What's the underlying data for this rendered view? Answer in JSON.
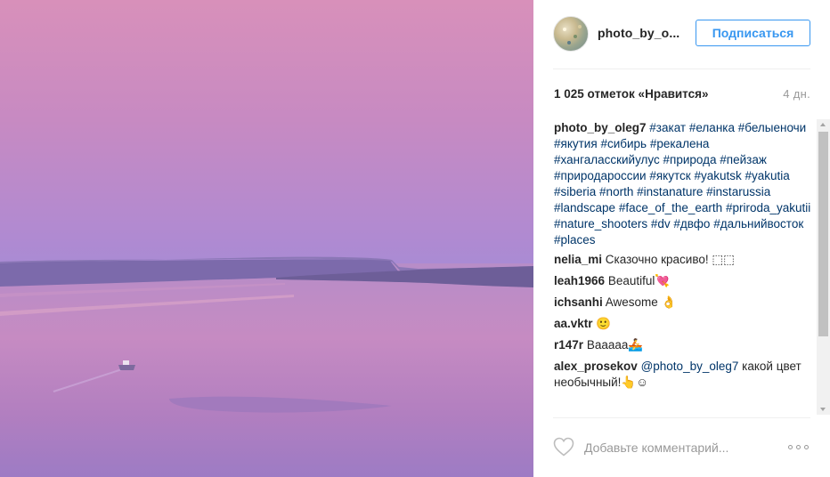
{
  "post": {
    "username": "photo_by_o...",
    "follow_label": "Подписаться",
    "likes": "1 025 отметок «Нравится»",
    "time": "4 дн.",
    "caption": {
      "user": "photo_by_oleg7",
      "tags": [
        "#закат",
        "#еланка",
        "#белыеночи",
        "#якутия",
        "#сибирь",
        "#рекалена",
        "#хангаласскийулус",
        "#природа",
        "#пейзаж",
        "#природароссии",
        "#якутск",
        "#yakutsk",
        "#yakutia",
        "#siberia",
        "#north",
        "#instanature",
        "#instarussia",
        "#landscape",
        "#face_of_the_earth",
        "#priroda_yakutii",
        "#nature_shooters",
        "#dv",
        "#двфо",
        "#дальнийвосток",
        "#places"
      ]
    },
    "comments": [
      {
        "user": "nelia_mi",
        "text": "Сказочно красиво! ⬚⬚"
      },
      {
        "user": "leah1966",
        "text": "Beautiful💘"
      },
      {
        "user": "ichsanhi",
        "text": "Awesome 👌"
      },
      {
        "user": "aa.vktr",
        "text": "🙂"
      },
      {
        "user": "r147r",
        "text": "Вааааа🚣"
      },
      {
        "user": "alex_prosekov",
        "mention": "@photo_by_oleg7",
        "text": "какой цвет необычный!👆☺"
      }
    ],
    "comment_placeholder": "Добавьте комментарий..."
  },
  "colors": {
    "accent": "#3897f0",
    "hashtag": "#003569",
    "sky_top": "#d98fbc",
    "water": "#b083c3"
  }
}
